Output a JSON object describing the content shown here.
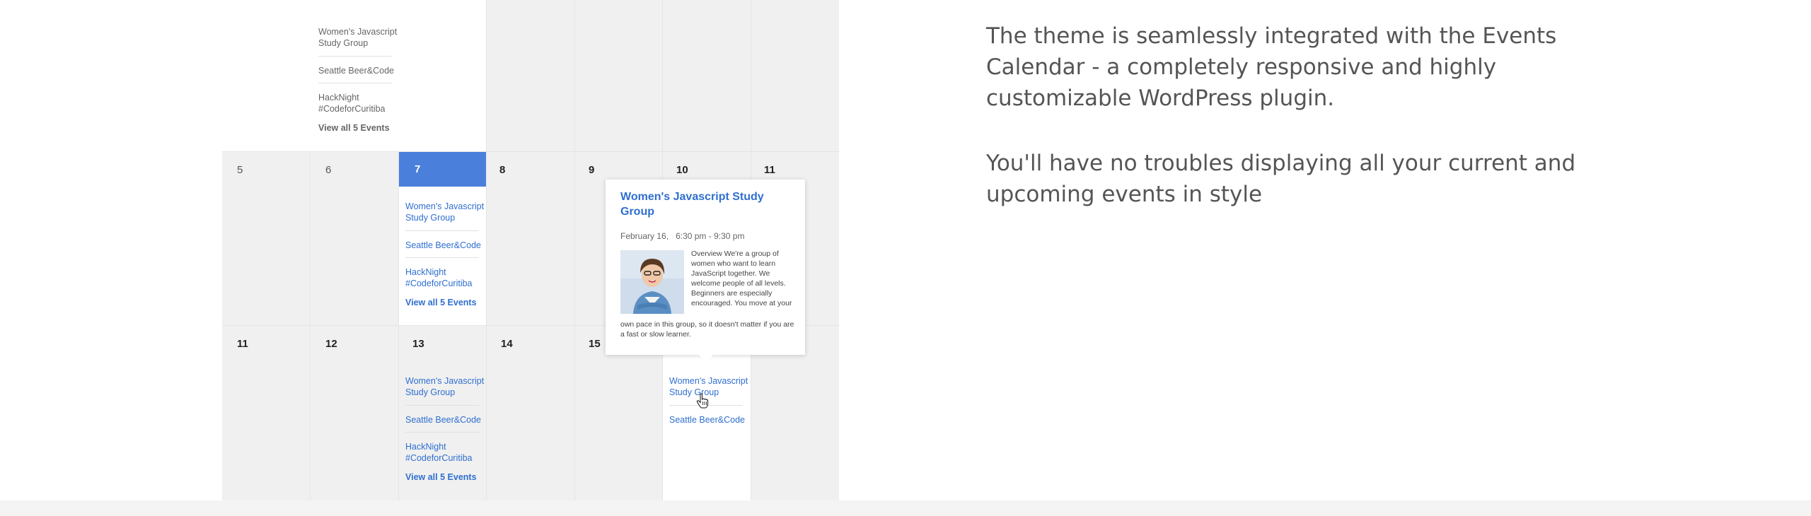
{
  "calendar": {
    "top_row": {
      "events": [
        "Women's Javascript Study Group",
        "Seattle Beer&Code",
        "HackNight #CodeforCuritiba"
      ],
      "view_all": "View all 5 Events"
    },
    "week2": {
      "days": [
        "5",
        "6",
        "7",
        "8",
        "9",
        "10",
        "11"
      ],
      "today_events": [
        "Women's Javascript Study Group",
        "Seattle Beer&Code",
        "HackNight #CodeforCuritiba"
      ],
      "view_all": "View all 5 Events"
    },
    "week3": {
      "days": [
        "11",
        "12",
        "13",
        "14",
        "15"
      ],
      "day13_events": [
        "Women's Javascript Study Group",
        "Seattle Beer&Code",
        "HackNight #CodeforCuritiba"
      ],
      "view_all": "View all 5 Events",
      "day16_events": [
        "Women's Javascript Study Group",
        "Seattle Beer&Code"
      ]
    },
    "tooltip": {
      "title": "Women's Javascript Study Group",
      "date": "February 16,",
      "time": "6:30 pm - 9:30 pm",
      "desc_part1": "Overview We're a group of women who want to learn JavaScript together. We welcome people of all levels. Beginners are especially encouraged. You move at your",
      "desc_part2": "own pace in this group, so it doesn't matter if you are a fast or slow learner."
    },
    "colors": {
      "today": "#4a7fdc",
      "event_link": "#2f6fd0",
      "cell_bg": "#f0f0f0"
    }
  },
  "copy": {
    "paragraph1": "The theme is seamlessly integrated with the Events Calendar - a completely responsive and highly customizable WordPress plugin.",
    "paragraph2": "You'll have no troubles displaying all your current and upcoming events in style"
  }
}
